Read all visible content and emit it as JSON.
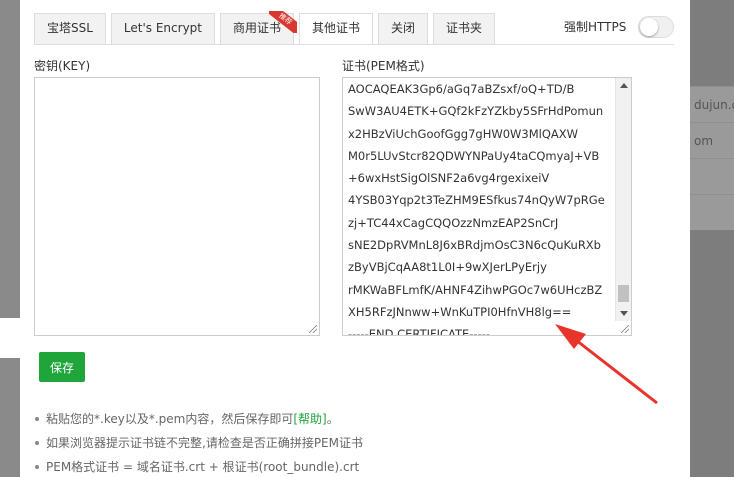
{
  "tabs": [
    {
      "label": "宝塔SSL",
      "active": false
    },
    {
      "label": "Let's Encrypt",
      "active": false
    },
    {
      "label": "商用证书",
      "active": false,
      "ribbon": "推荐"
    },
    {
      "label": "其他证书",
      "active": true
    },
    {
      "label": "关闭",
      "active": false
    },
    {
      "label": "证书夹",
      "active": false
    }
  ],
  "force_https": {
    "label": "强制HTTPS",
    "enabled": false
  },
  "key": {
    "label": "密钥(KEY)",
    "value": ""
  },
  "cert": {
    "label": "证书(PEM格式)",
    "lines": [
      "AOCAQEAK3Gp6/aGq7aBZsxf/oQ+TD/B",
      "SwW3AU4ETK+GQf2kFzYZkby5SFrHdPomun",
      "x2HBzViUchGoofGgg7gHW0W3MlQAXW",
      "M0r5LUvStcr82QDWYNPaUy4taCQmyaJ+VB",
      "+6wxHstSigOlSNF2a6vg4rgexixeiV",
      "4YSB03Yqp2t3TeZHM9ESfkus74nQyW7pRGe",
      "zj+TC44xCagCQQOzzNmzEAP2SnCrJ",
      "sNE2DpRVMnL8J6xBRdjmOsC3N6cQuKuRXb",
      "zByVBjCqAA8t1L0I+9wXJerLPyErjy",
      "rMKWaBFLmfK/AHNF4ZihwPGOc7w6UHczBZ",
      "XH5RFzJNnww+WnKuTPI0HfnVH8lg==",
      "-----END CERTIFICATE-----"
    ]
  },
  "save_label": "保存",
  "tips": {
    "tip1_text": "粘贴您的*.key以及*.pem内容，然后保存即可",
    "tip1_help": "[帮助]",
    "tip1_end": "。",
    "tip2": "如果浏览器提示证书链不完整,请检查是否正确拼接PEM证书",
    "tip3": "PEM格式证书 = 域名证书.crt + 根证书(root_bundle).crt"
  },
  "background": {
    "row1": "dujun.c",
    "row2": "om"
  },
  "colors": {
    "accent": "#20a53a",
    "annotation": "#e8342b"
  }
}
